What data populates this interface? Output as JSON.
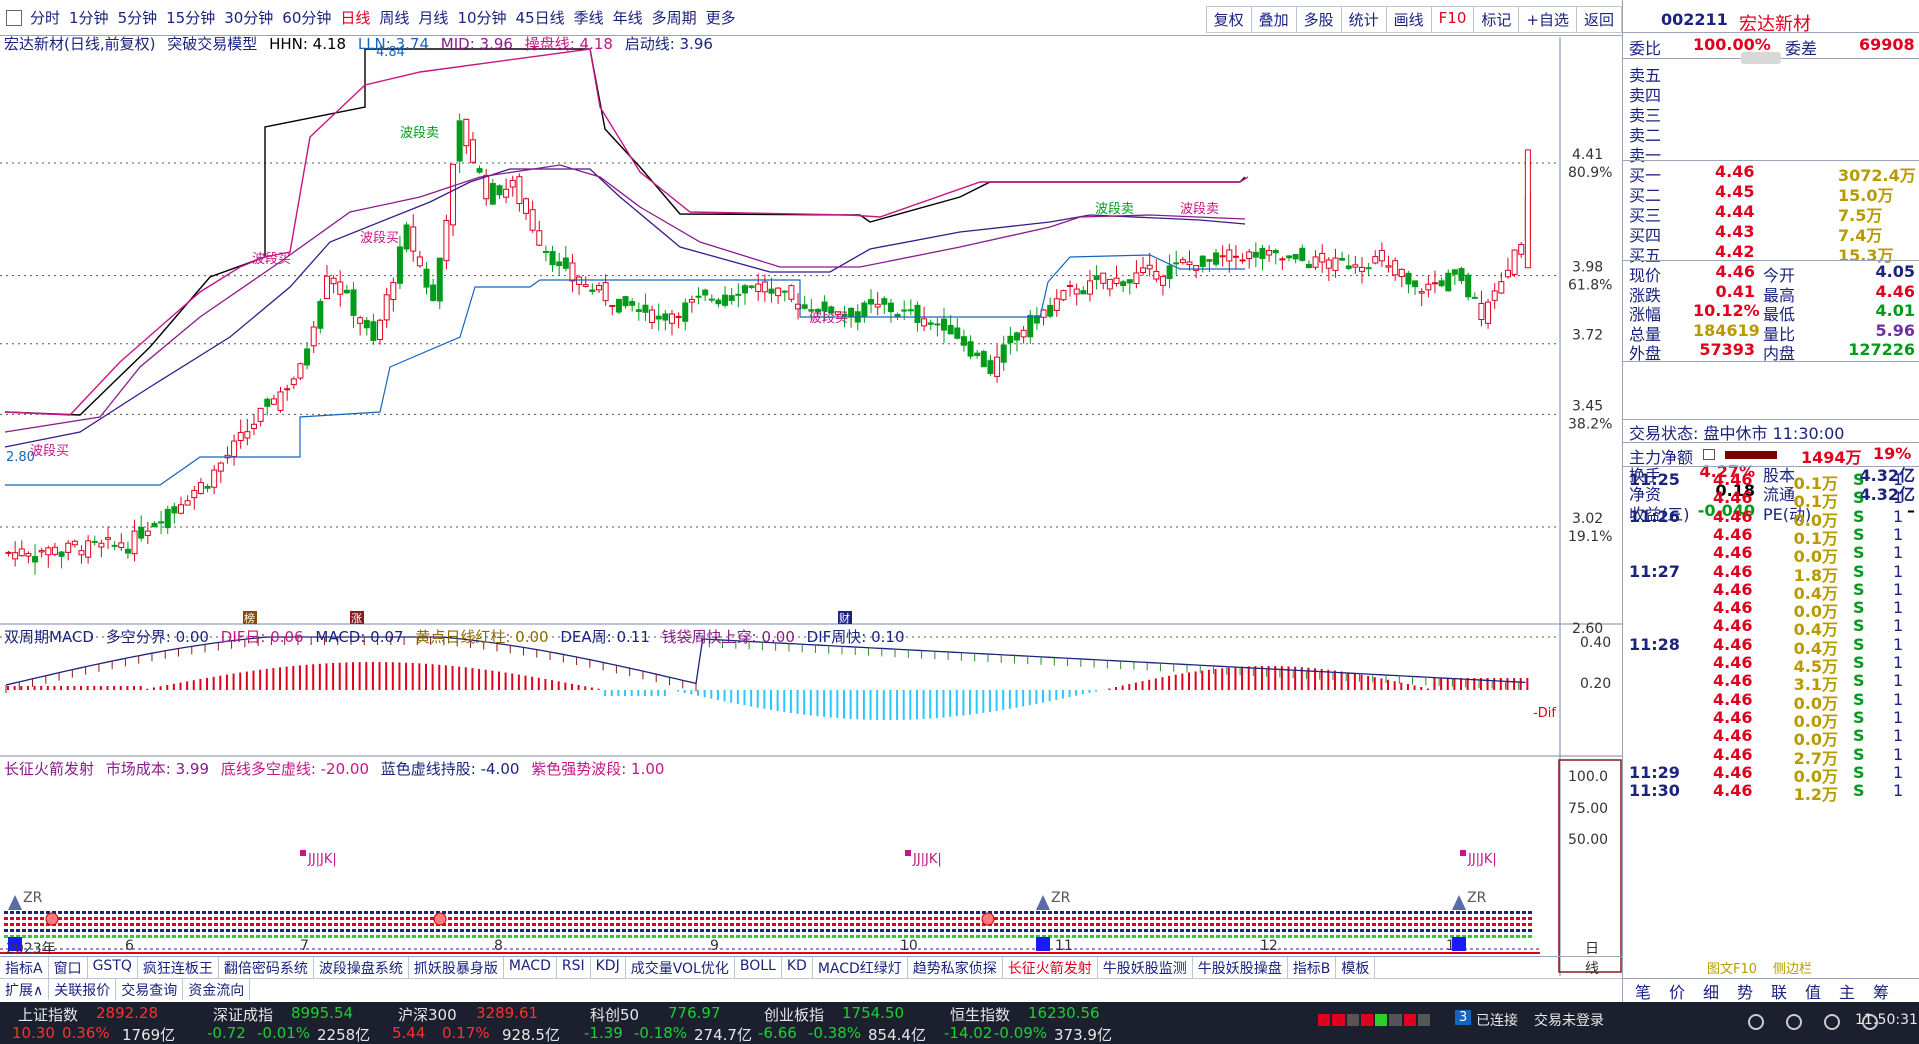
{
  "toolbar": {
    "periods": [
      "分时",
      "1分钟",
      "5分钟",
      "15分钟",
      "30分钟",
      "60分钟",
      "日线",
      "周线",
      "月线",
      "10分钟",
      "45日线",
      "季线",
      "年线",
      "多周期",
      "更多"
    ],
    "active": "日线",
    "buttons": [
      "复权",
      "叠加",
      "多股",
      "统计",
      "画线",
      "F10",
      "标记",
      "+自选",
      "返回"
    ]
  },
  "main": {
    "name": "宏达新材(日线,前复权)",
    "model": "突破交易模型",
    "hhn": "HHN: 4.18",
    "lln": "LLN: 3.74",
    "mid": "MID: 3.96",
    "caopan": "操盘线: 4.18",
    "qidong": "启动线: 3.96",
    "yticks": [
      {
        "v": "4.41",
        "p": "80.9%"
      },
      {
        "v": "3.98",
        "p": "61.8%"
      },
      {
        "v": "3.72",
        "p": ""
      },
      {
        "v": "3.45",
        "p": "38.2%"
      },
      {
        "v": "3.02",
        "p": "19.1%"
      },
      {
        "v": "2.60",
        "p": ""
      }
    ],
    "annotations": {
      "high": "4.84",
      "low": "2.80",
      "b1": "波段买",
      "b2": "波段买",
      "b3": "波段买",
      "s1": "波段卖",
      "s2": "波段卖",
      "s3": "波段卖",
      "b4": "波段买"
    },
    "markers": [
      "榜",
      "涨",
      "财"
    ]
  },
  "macd": {
    "name": "双周期MACD",
    "a": "多空分界: 0.00",
    "b": "DIF日: 0.06",
    "c": "MACD: 0.07",
    "d": "黄点日线红柱: 0.00",
    "e": "DEA周: 0.11",
    "f": "钱袋周快上穿: 0.00",
    "g": "DIF周快: 0.10",
    "yticks": [
      "0.40",
      "0.20"
    ],
    "tag": "-Dif"
  },
  "rocket": {
    "name": "长征火箭发射",
    "a": "市场成本: 3.99",
    "b": "底线多空虚线: -20.00",
    "c": "蓝色虚线持股: -4.00",
    "d": "紫色强势波段: 1.00",
    "yticks": [
      "100.0",
      "75.00",
      "50.00"
    ],
    "jj": "JJ|JK|",
    "zr": "ZR"
  },
  "xaxis": [
    "2023年",
    "6",
    "7",
    "8",
    "9",
    "10",
    "11",
    "12",
    "1",
    "日线"
  ],
  "indicators": [
    "指标A",
    "窗口",
    "GSTQ",
    "疯狂连板王",
    "翻倍密码系统",
    "波段操盘系统",
    "抓妖股暴身版",
    "MACD",
    "RSI",
    "KDJ",
    "成交量VOL优化",
    "BOLL",
    "KD",
    "MACD红绿灯",
    "趋势私家侦探",
    "长征火箭发射",
    "牛股妖股监测",
    "牛股妖股操盘",
    "指标B",
    "模板"
  ],
  "indicators2": [
    "扩展∧",
    "关联报价",
    "交易查询",
    "资金流向"
  ],
  "quote": {
    "code": "002211",
    "name": "宏达新材",
    "weibi_l": "委比",
    "weibi": "100.00%",
    "weicha_l": "委差",
    "weicha": "69908",
    "sell": [
      {
        "l": "卖五",
        "p": "",
        "v": ""
      },
      {
        "l": "卖四",
        "p": "",
        "v": ""
      },
      {
        "l": "卖三",
        "p": "",
        "v": ""
      },
      {
        "l": "卖二",
        "p": "",
        "v": ""
      },
      {
        "l": "卖一",
        "p": "",
        "v": ""
      }
    ],
    "buy": [
      {
        "l": "买一",
        "p": "4.46",
        "v": "3072.4万"
      },
      {
        "l": "买二",
        "p": "4.45",
        "v": "15.0万"
      },
      {
        "l": "买三",
        "p": "4.44",
        "v": "7.5万"
      },
      {
        "l": "买四",
        "p": "4.43",
        "v": "7.4万"
      },
      {
        "l": "买五",
        "p": "4.42",
        "v": "15.3万"
      }
    ],
    "stats": [
      [
        "现价",
        "4.46",
        "今开",
        "4.05"
      ],
      [
        "涨跌",
        "0.41",
        "最高",
        "4.46"
      ],
      [
        "涨幅",
        "10.12%",
        "最低",
        "4.01"
      ],
      [
        "总量",
        "184619",
        "量比",
        "5.96"
      ],
      [
        "外盘",
        "57393",
        "内盘",
        "127226"
      ],
      [
        "换手",
        "4.27%",
        "股本",
        "4.32亿"
      ],
      [
        "净资",
        "0.18",
        "流通",
        "4.32亿"
      ],
      [
        "收益(三)",
        "-0.040",
        "PE(动)",
        "–"
      ]
    ],
    "status": "交易状态: 盘中休市 11:30:00",
    "zl_l": "主力净额",
    "zl": "1494万",
    "zl_p": "19%",
    "ticks": [
      [
        "11:25",
        "4.46",
        "0.1万",
        "S",
        "1"
      ],
      [
        "",
        "4.46",
        "0.1万",
        "S",
        "1"
      ],
      [
        "11:26",
        "4.46",
        "0.0万",
        "S",
        "1"
      ],
      [
        "",
        "4.46",
        "0.1万",
        "S",
        "1"
      ],
      [
        "",
        "4.46",
        "0.0万",
        "S",
        "1"
      ],
      [
        "11:27",
        "4.46",
        "1.8万",
        "S",
        "1"
      ],
      [
        "",
        "4.46",
        "0.4万",
        "S",
        "1"
      ],
      [
        "",
        "4.46",
        "0.0万",
        "S",
        "1"
      ],
      [
        "",
        "4.46",
        "0.4万",
        "S",
        "1"
      ],
      [
        "11:28",
        "4.46",
        "0.4万",
        "S",
        "1"
      ],
      [
        "",
        "4.46",
        "4.5万",
        "S",
        "1"
      ],
      [
        "",
        "4.46",
        "3.1万",
        "S",
        "1"
      ],
      [
        "",
        "4.46",
        "0.0万",
        "S",
        "1"
      ],
      [
        "",
        "4.46",
        "0.0万",
        "S",
        "1"
      ],
      [
        "",
        "4.46",
        "0.0万",
        "S",
        "1"
      ],
      [
        "",
        "4.46",
        "2.7万",
        "S",
        "1"
      ],
      [
        "11:29",
        "4.46",
        "0.0万",
        "S",
        "1"
      ],
      [
        "11:30",
        "4.46",
        "1.2万",
        "S",
        "1"
      ]
    ],
    "bottomtabs": [
      "笔",
      "价",
      "细",
      "势",
      "联",
      "值",
      "主",
      "筹"
    ],
    "f10": "图文F10",
    "ce": "侧边栏"
  },
  "indices": [
    {
      "n": "上证指数",
      "v": "2892.28",
      "c": "10.30",
      "p": "0.36%",
      "a": "1769亿"
    },
    {
      "n": "深证成指",
      "v": "8995.54",
      "c": "-0.72",
      "p": "-0.01%",
      "a": "2258亿"
    },
    {
      "n": "沪深300",
      "v": "3289.61",
      "c": "5.44",
      "p": "0.17%",
      "a": "928.5亿"
    },
    {
      "n": "科创50",
      "v": "776.97",
      "c": "-1.39",
      "p": "-0.18%",
      "a": "274.7亿"
    },
    {
      "n": "创业板指",
      "v": "1754.50",
      "c": "-6.66",
      "p": "-0.38%",
      "a": "854.4亿"
    },
    {
      "n": "恒生指数",
      "v": "16230.56",
      "c": "-14.02",
      "p": "-0.09%",
      "a": "373.9亿"
    }
  ],
  "statusbar": {
    "num": "3",
    "conn": "已连接",
    "login": "交易未登录",
    "time": "11:50:31"
  }
}
